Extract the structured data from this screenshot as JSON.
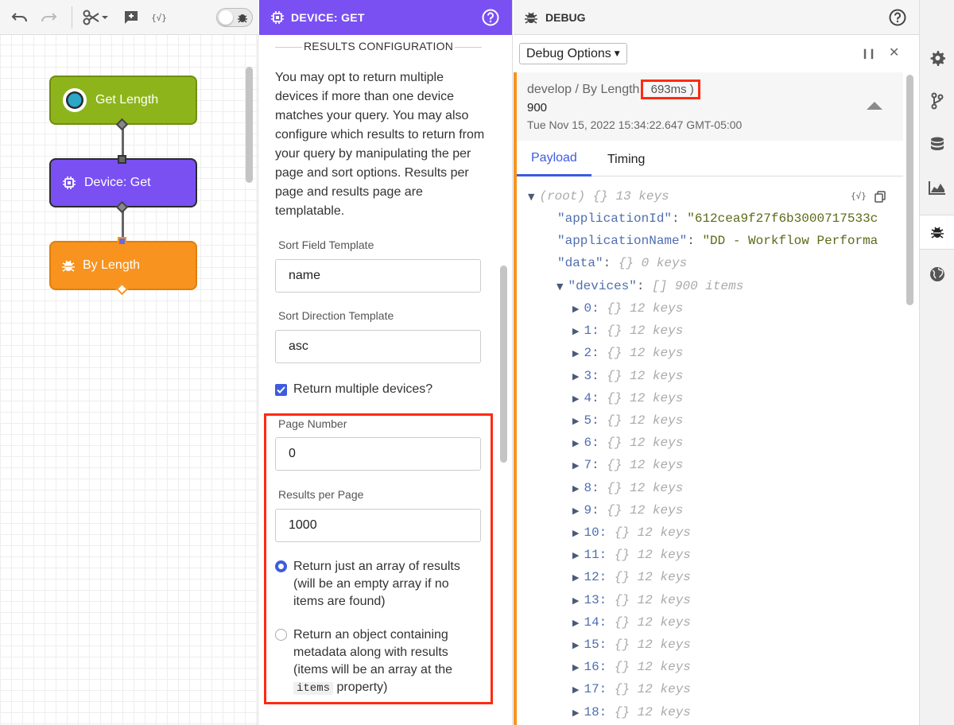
{
  "canvas": {
    "nodes": [
      {
        "label": "Get Length",
        "type": "trigger"
      },
      {
        "label": "Device: Get",
        "type": "device"
      },
      {
        "label": "By Length",
        "type": "debug"
      }
    ]
  },
  "colors": {
    "accent_purple": "#7a50f2",
    "trigger_green": "#8db51b",
    "debug_orange": "#f7931e",
    "highlight_red": "#ff2a12",
    "link_blue": "#3d5ce0"
  },
  "panel": {
    "title": "DEVICE: GET",
    "section_title": "RESULTS CONFIGURATION",
    "description": "You may opt to return multiple devices if more than one device matches your query. You may also configure which results to return from your query by manipulating the per page and sort options. Results per page and results page are templatable.",
    "sort_field_label": "Sort Field Template",
    "sort_field_value": "name",
    "sort_direction_label": "Sort Direction Template",
    "sort_direction_value": "asc",
    "return_multiple_label": "Return multiple devices?",
    "page_number_label": "Page Number",
    "page_number_value": "0",
    "results_per_page_label": "Results per Page",
    "results_per_page_value": "1000",
    "radio_array_label": "Return just an array of results (will be an empty array if no items are found)",
    "radio_object_prefix": "Return an object containing metadata along with results (items will be an array at the",
    "radio_object_code": "items",
    "radio_object_suffix": "property)"
  },
  "debug": {
    "title": "DEBUG",
    "options_label": "Debug Options",
    "message": {
      "path": "develop / By Length",
      "duration": "693ms",
      "value": "900",
      "timestamp": "Tue Nov 15, 2022 15:34:22.647 GMT-05:00"
    },
    "tabs": [
      "Payload",
      "Timing"
    ],
    "tree": {
      "root_label": "(root)",
      "root_meta": "{} 13 keys",
      "application_id_key": "\"applicationId\"",
      "application_id_value": "\"612cea9f27f6b3000717533c",
      "application_name_key": "\"applicationName\"",
      "application_name_value": "\"DD - Workflow Performa",
      "data_key": "\"data\"",
      "data_meta": "{} 0 keys",
      "devices_key": "\"devices\"",
      "devices_meta": "[] 900 items",
      "item_meta": "{} 12 keys",
      "items": [
        "0",
        "1",
        "2",
        "3",
        "4",
        "5",
        "6",
        "7",
        "8",
        "9",
        "10",
        "11",
        "12",
        "13",
        "14",
        "15",
        "16",
        "17",
        "18"
      ]
    }
  },
  "rail": {
    "icons": [
      "gear-icon",
      "branch-icon",
      "database-icon",
      "chart-icon",
      "bug-icon",
      "globe-icon"
    ],
    "active": "bug-icon"
  }
}
